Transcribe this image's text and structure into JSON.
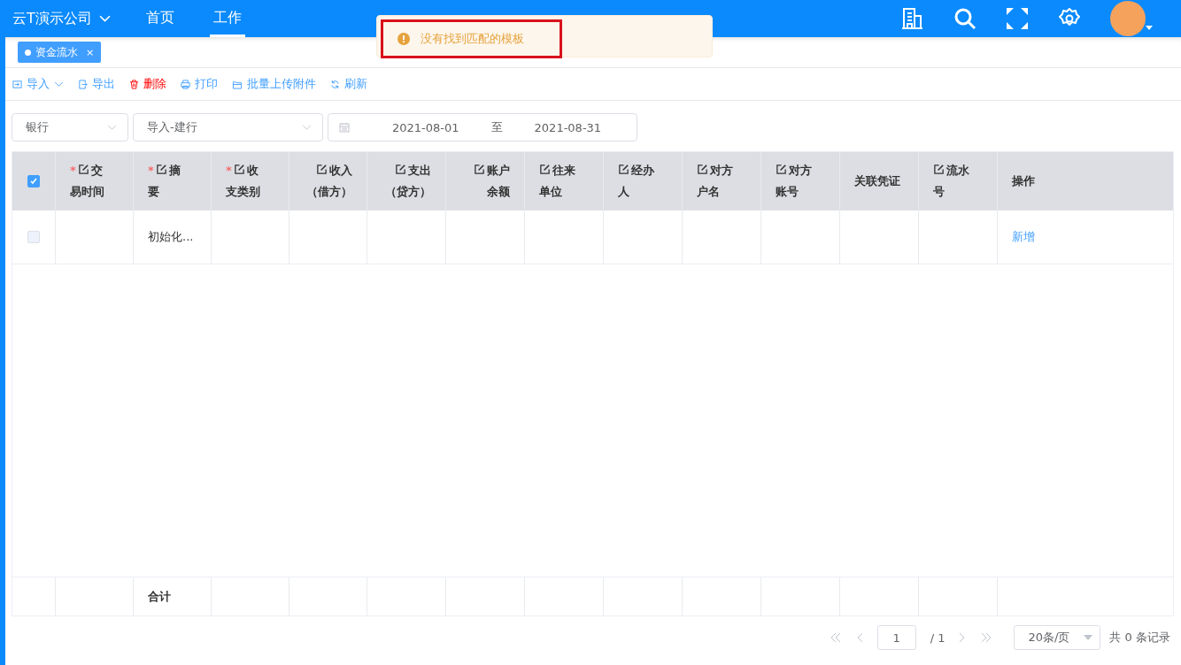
{
  "header": {
    "company": "云T演示公司",
    "nav": [
      {
        "label": "首页",
        "selected": false
      },
      {
        "label": "工作",
        "selected": true
      }
    ]
  },
  "toast": {
    "message": "没有找到匹配的模板",
    "highlighted": true
  },
  "tabs": [
    {
      "label": "资金流水",
      "selected": true,
      "close": "×"
    }
  ],
  "toolbar": [
    {
      "label": "导入",
      "kind": "import",
      "danger": false,
      "dropdown": true
    },
    {
      "label": "导出",
      "kind": "export",
      "danger": false,
      "dropdown": false
    },
    {
      "label": "删除",
      "kind": "delete",
      "danger": true,
      "dropdown": false
    },
    {
      "label": "打印",
      "kind": "print",
      "danger": false,
      "dropdown": false
    },
    {
      "label": "批量上传附件",
      "kind": "upload",
      "danger": false,
      "dropdown": false
    },
    {
      "label": "刷新",
      "kind": "refresh",
      "danger": false,
      "dropdown": false
    }
  ],
  "filters": {
    "account_type": "银行",
    "template": "导入-建行",
    "date_from": "2021-08-01",
    "date_sep": "至",
    "date_to": "2021-08-31"
  },
  "table": {
    "all_checked": true,
    "columns": [
      {
        "label": "交易时间",
        "required_mark": "*",
        "editable": true
      },
      {
        "label": "摘要",
        "required_mark": "*",
        "editable": true
      },
      {
        "label": "收支类别",
        "required_mark": "*",
        "editable": true
      },
      {
        "label": "收入（借方）",
        "editable": true
      },
      {
        "label": "支出（贷方）",
        "editable": true
      },
      {
        "label": "账户余额",
        "editable": true
      },
      {
        "label": "往来单位",
        "editable": true
      },
      {
        "label": "经办人",
        "editable": true
      },
      {
        "label": "对方户名",
        "editable": true
      },
      {
        "label": "对方账号",
        "editable": true
      },
      {
        "label": "关联凭证",
        "editable": false
      },
      {
        "label": "流水号",
        "editable": true
      },
      {
        "label": "操作",
        "editable": false
      }
    ],
    "rows": [
      {
        "checked": false,
        "summary": "初始化...",
        "action": "新增"
      }
    ],
    "footer": {
      "total_label": "合计"
    }
  },
  "pagination": {
    "page": "1",
    "total_pages": "/ 1",
    "page_size": "20条/页",
    "total": "共 0 条记录"
  }
}
